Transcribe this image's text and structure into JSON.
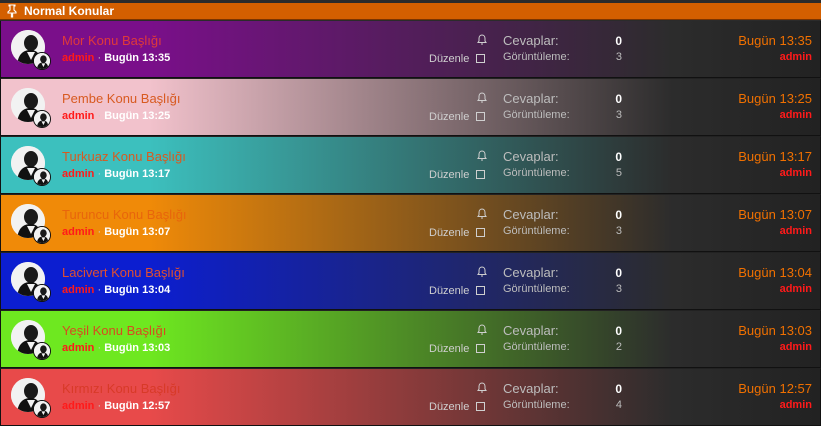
{
  "header": {
    "title": "Normal Konular",
    "icon": "pin-icon"
  },
  "labels": {
    "edit": "Düzenle",
    "replies": "Cevaplar:",
    "views": "Görüntüleme:",
    "separator": "·"
  },
  "topics": [
    {
      "title": "Mor Konu Başlığı",
      "author": "admin",
      "date": "Bugün 13:35",
      "replies": "0",
      "views": "3",
      "last_date": "Bugün 13:35",
      "last_author": "admin",
      "color": "#7a0f8a",
      "title_color": "#e03a3a"
    },
    {
      "title": "Pembe Konu Başlığı",
      "author": "admin",
      "date": "Bugün 13:25",
      "replies": "0",
      "views": "3",
      "last_date": "Bugün 13:25",
      "last_author": "admin",
      "color": "#f2c2cc",
      "title_color": "#d85a20"
    },
    {
      "title": "Turkuaz Konu Başlığı",
      "author": "admin",
      "date": "Bugün 13:17",
      "replies": "0",
      "views": "5",
      "last_date": "Bugün 13:17",
      "last_author": "admin",
      "color": "#3cc0be",
      "title_color": "#d85a20"
    },
    {
      "title": "Turuncu Konu Başlığı",
      "author": "admin",
      "date": "Bugün 13:07",
      "replies": "0",
      "views": "3",
      "last_date": "Bugün 13:07",
      "last_author": "admin",
      "color": "#f08a08",
      "title_color": "#e8650c"
    },
    {
      "title": "Lacivert Konu Başlığı",
      "author": "admin",
      "date": "Bugün 13:04",
      "replies": "0",
      "views": "3",
      "last_date": "Bugün 13:04",
      "last_author": "admin",
      "color": "#0c1ed0",
      "title_color": "#e05030"
    },
    {
      "title": "Yeşil Konu Başlığı",
      "author": "admin",
      "date": "Bugün 13:03",
      "replies": "0",
      "views": "2",
      "last_date": "Bugün 13:03",
      "last_author": "admin",
      "color": "#6ee820",
      "title_color": "#d84a20"
    },
    {
      "title": "Kırmızı Konu Başlığı",
      "author": "admin",
      "date": "Bugün 12:57",
      "replies": "0",
      "views": "4",
      "last_date": "Bugün 12:57",
      "last_author": "admin",
      "color": "#e84a4a",
      "title_color": "#d83a28"
    }
  ]
}
